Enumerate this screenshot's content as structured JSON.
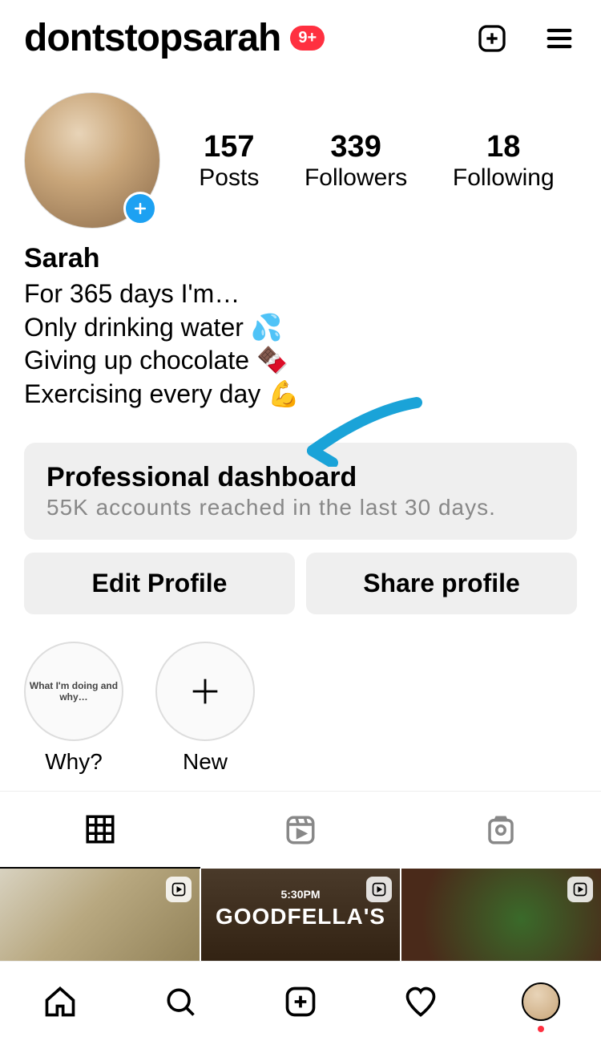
{
  "header": {
    "username": "dontstopsarah",
    "notifications_badge": "9+"
  },
  "stats": {
    "posts_count": "157",
    "posts_label": "Posts",
    "followers_count": "339",
    "followers_label": "Followers",
    "following_count": "18",
    "following_label": "Following"
  },
  "bio": {
    "display_name": "Sarah",
    "line1": "For 365 days I'm…",
    "line2": "Only drinking water 💦",
    "line3": "Giving up chocolate 🍫",
    "line4": "Exercising every day 💪"
  },
  "dashboard": {
    "title": "Professional dashboard",
    "subtitle": "55K accounts reached in the last 30 days."
  },
  "actions": {
    "edit": "Edit Profile",
    "share": "Share profile"
  },
  "highlights": {
    "h1_inner": "What I'm doing and why…",
    "h1_label": "Why?",
    "new_label": "New"
  },
  "posts": {
    "p2_time": "5:30PM",
    "p2_brand": "GOODFELLA'S"
  }
}
